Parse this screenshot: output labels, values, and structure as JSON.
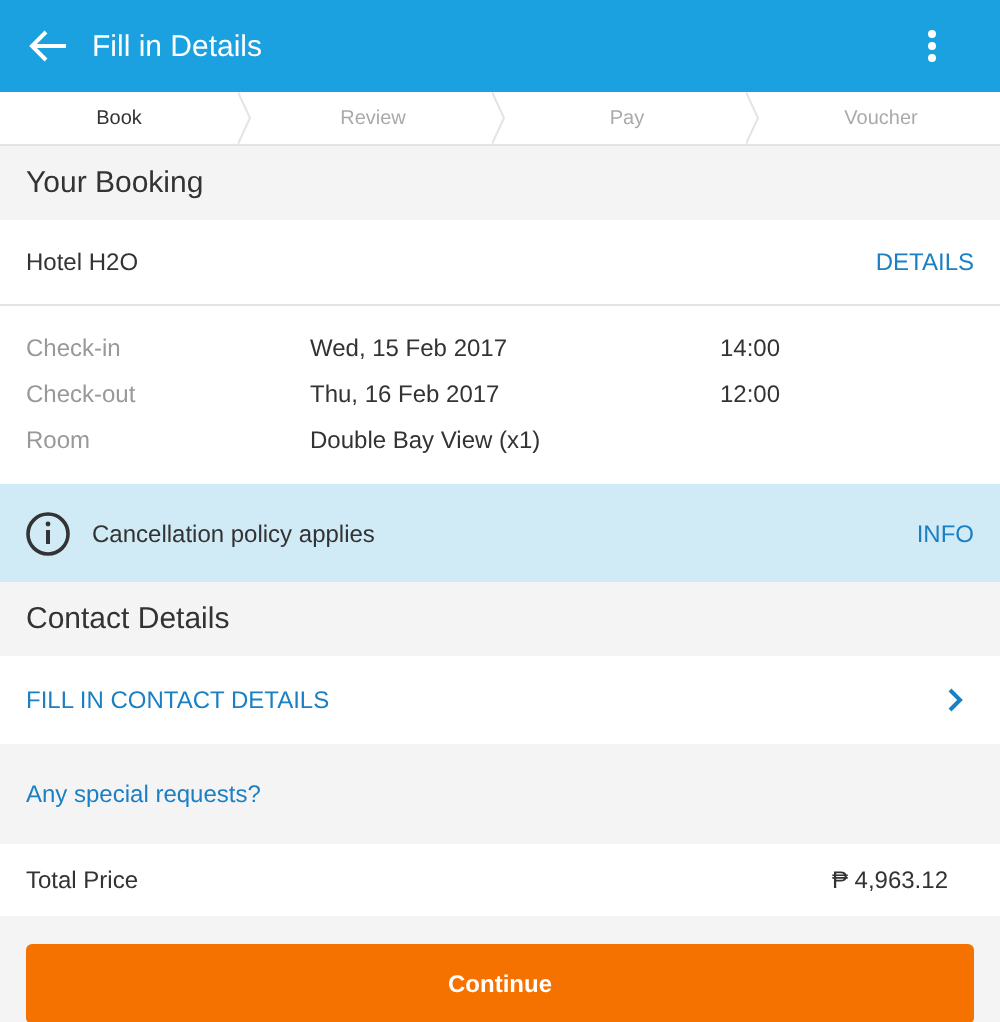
{
  "app_bar": {
    "title": "Fill in Details"
  },
  "steps": [
    {
      "label": "Book",
      "selected": true
    },
    {
      "label": "Review",
      "selected": false
    },
    {
      "label": "Pay",
      "selected": false
    },
    {
      "label": "Voucher",
      "selected": false
    }
  ],
  "booking": {
    "heading": "Your Booking",
    "hotel": "Hotel H2O",
    "details_link": "DETAILS",
    "rows": [
      {
        "label": "Check-in",
        "value": "Wed, 15 Feb 2017",
        "time": "14:00"
      },
      {
        "label": "Check-out",
        "value": "Thu, 16 Feb 2017",
        "time": "12:00"
      },
      {
        "label": "Room",
        "value": "Double Bay View (x1)"
      }
    ]
  },
  "notice": {
    "text": "Cancellation policy applies",
    "link": "INFO"
  },
  "contact": {
    "heading": "Contact Details",
    "fill_link": "FILL IN CONTACT DETAILS",
    "requests_link": "Any special requests?"
  },
  "total": {
    "label": "Total Price",
    "amount": "₱ 4,963.12"
  },
  "button": "Continue"
}
